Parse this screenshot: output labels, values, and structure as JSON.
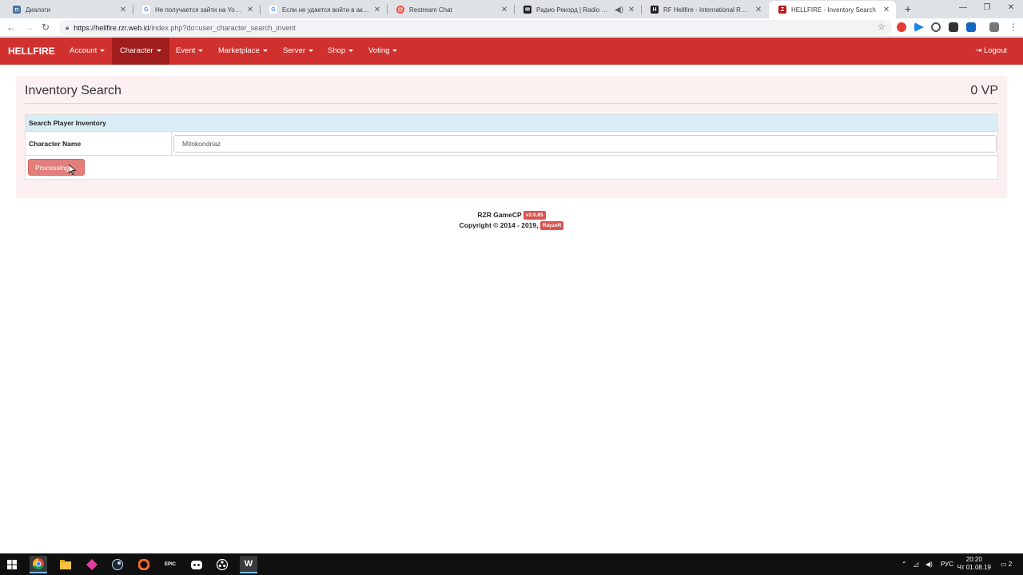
{
  "browser": {
    "tabs": [
      {
        "title": "Диалоги",
        "favicon_color": "#4a76a8",
        "favicon_glyph": "◘",
        "active": false
      },
      {
        "title": "Не получается зайти на YouTub",
        "favicon_color": "#4285f4",
        "favicon_glyph": "G",
        "active": false
      },
      {
        "title": "Если не удается войти в аккаун",
        "favicon_color": "#4285f4",
        "favicon_glyph": "G",
        "active": false
      },
      {
        "title": "Restream Chat",
        "favicon_color": "#e94b3c",
        "favicon_glyph": "@",
        "active": false
      },
      {
        "title": "Радио Рекорд | Radio Recor",
        "favicon_color": "#202124",
        "favicon_glyph": "✉",
        "active": false
      },
      {
        "title": "RF Hellfire - International RF Ser",
        "favicon_color": "#202124",
        "favicon_glyph": "H",
        "active": false
      },
      {
        "title": "HELLFIRE - Inventory Search",
        "favicon_color": "#b71c1c",
        "favicon_glyph": "Z",
        "active": true
      }
    ],
    "url_host": "https://hellfire.rzr.web.id",
    "url_path": "/index.php?do=user_character_search_invent"
  },
  "navbar": {
    "brand": "HELLFIRE",
    "items": [
      {
        "label": "Account",
        "active": false
      },
      {
        "label": "Character",
        "active": true
      },
      {
        "label": "Event",
        "active": false
      },
      {
        "label": "Marketplace",
        "active": false
      },
      {
        "label": "Server",
        "active": false
      },
      {
        "label": "Shop",
        "active": false
      },
      {
        "label": "Voting",
        "active": false
      }
    ],
    "logout_label": "Logout"
  },
  "page": {
    "title": "Inventory Search",
    "vp": "0 VP",
    "form_header": "Search Player Inventory",
    "character_name_label": "Character Name",
    "character_name_value": "Mitokondriaz",
    "submit_label": "Processing..."
  },
  "footer": {
    "product": "RZR GameCP",
    "version": "v2.6.85",
    "copyright": "Copyright © 2014 - 2019,",
    "author": "RayzeR"
  },
  "taskbar": {
    "lang": "РУС",
    "time": "20:20",
    "date": "Чт 01.08.19",
    "notifications": "2"
  },
  "colors": {
    "brand_red": "#d0312e",
    "active_nav": "#a11d1b",
    "panel_bg": "#fdf0f0",
    "form_header_bg": "#d9edf7",
    "button_red": "#d9534f"
  }
}
